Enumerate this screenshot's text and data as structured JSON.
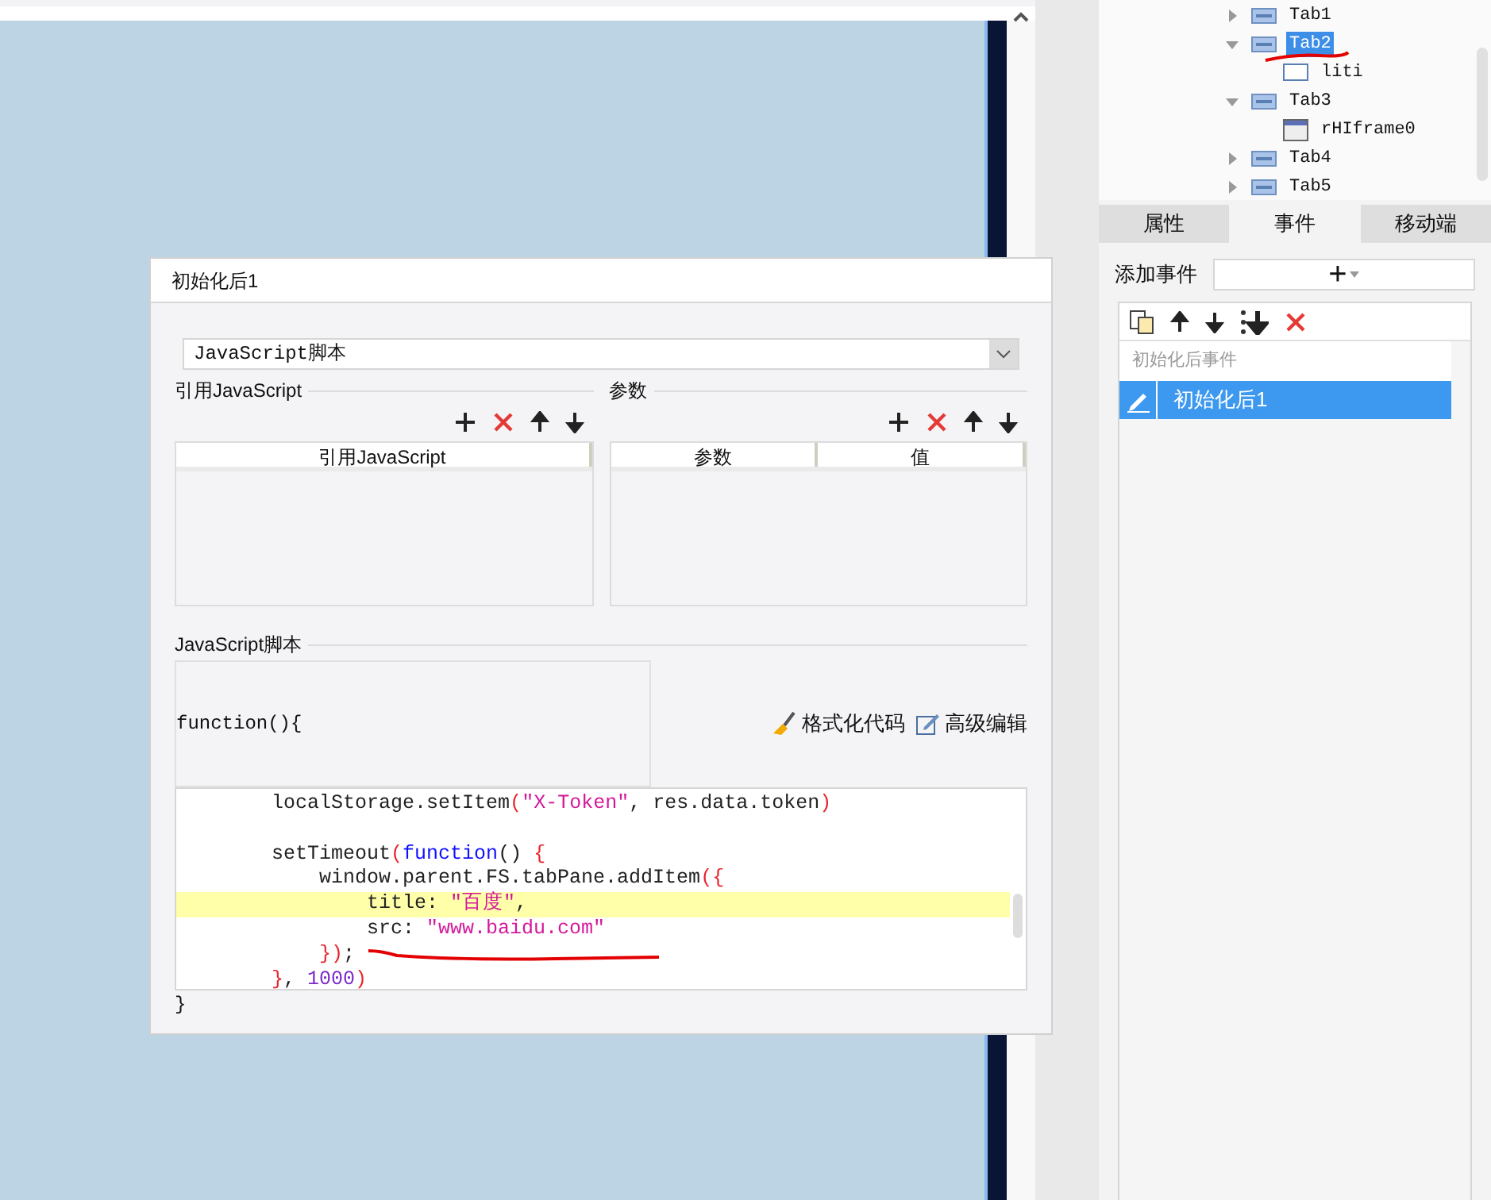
{
  "tree": {
    "items": [
      {
        "label": "Tab1",
        "kind": "tab",
        "expanded": false,
        "selected": false
      },
      {
        "label": "Tab2",
        "kind": "tab",
        "expanded": true,
        "selected": true,
        "children": [
          {
            "label": "liti",
            "kind": "box",
            "selected": false
          }
        ]
      },
      {
        "label": "Tab3",
        "kind": "tab",
        "expanded": true,
        "selected": false,
        "children": [
          {
            "label": "rHIframe0",
            "kind": "frame",
            "selected": false
          }
        ]
      },
      {
        "label": "Tab4",
        "kind": "tab",
        "expanded": false,
        "selected": false
      },
      {
        "label": "Tab5",
        "kind": "tab",
        "expanded": false,
        "selected": false
      }
    ]
  },
  "panel_tabs": [
    {
      "label": "属性",
      "selected": false
    },
    {
      "label": "事件",
      "selected": true
    },
    {
      "label": "移动端",
      "selected": false
    }
  ],
  "add_event": {
    "label": "添加事件",
    "button": "+"
  },
  "event_list": {
    "group": "初始化后事件",
    "items": [
      {
        "label": "初始化后1",
        "selected": true
      }
    ]
  },
  "dialog": {
    "title": "初始化后1",
    "type_select": {
      "value": "JavaScript脚本"
    },
    "ref_section": {
      "title": "引用JavaScript",
      "columns": [
        "引用JavaScript"
      ]
    },
    "params_section": {
      "title": "参数",
      "columns": [
        "参数",
        "值"
      ]
    },
    "script_section": {
      "title": "JavaScript脚本",
      "header": "function(){",
      "format_button": "格式化代码",
      "advanced_button": "高级编辑",
      "footer": "}",
      "code_lines": [
        {
          "highlighted": false,
          "tokens": [
            {
              "text": "        localStorage.setItem",
              "kind": "plain"
            },
            {
              "text": "(",
              "kind": "bracket"
            },
            {
              "text": "\"X-Token\"",
              "kind": "string"
            },
            {
              "text": ", res.data.token",
              "kind": "plain"
            },
            {
              "text": ")",
              "kind": "bracket"
            }
          ]
        },
        {
          "highlighted": false
        },
        {
          "highlighted": false,
          "tokens": [
            {
              "text": "        setTimeout",
              "kind": "plain"
            },
            {
              "text": "(",
              "kind": "bracket"
            },
            {
              "text": "function",
              "kind": "keyword"
            },
            {
              "text": "() ",
              "kind": "plain"
            },
            {
              "text": "{",
              "kind": "bracket"
            }
          ]
        },
        {
          "highlighted": false,
          "tokens": [
            {
              "text": "            window.parent.FS.tabPane.addItem",
              "kind": "plain"
            },
            {
              "text": "({",
              "kind": "bracket"
            }
          ]
        },
        {
          "highlighted": true,
          "tokens": [
            {
              "text": "                title: ",
              "kind": "plain"
            },
            {
              "text": "\"百度\"",
              "kind": "string"
            },
            {
              "text": ",",
              "kind": "plain"
            }
          ]
        },
        {
          "highlighted": false,
          "tokens": [
            {
              "text": "                src: ",
              "kind": "plain"
            },
            {
              "text": "\"www.baidu.com\"",
              "kind": "string"
            }
          ]
        },
        {
          "highlighted": false,
          "tokens": [
            {
              "text": "            })",
              "kind": "bracket"
            },
            {
              "text": ";",
              "kind": "plain"
            }
          ]
        },
        {
          "highlighted": false,
          "tokens": [
            {
              "text": "        }",
              "kind": "bracket"
            },
            {
              "text": ", ",
              "kind": "plain"
            },
            {
              "text": "1000",
              "kind": "number"
            },
            {
              "text": ")",
              "kind": "bracket"
            }
          ]
        }
      ]
    }
  }
}
